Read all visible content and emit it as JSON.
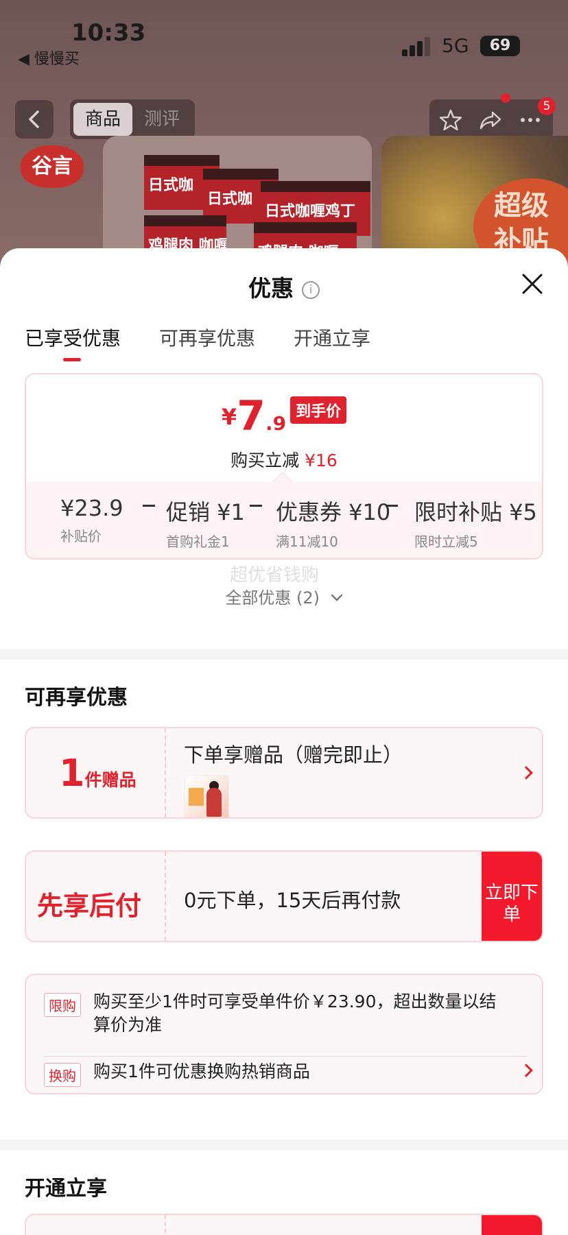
{
  "status_bar": {
    "time": "10:33",
    "back_app": "◀ 慢慢买",
    "network": "5G",
    "battery": "69"
  },
  "product_header": {
    "tabs": [
      "商品",
      "测评"
    ],
    "active_tab": "商品",
    "cart_count": "5",
    "brand_logo": "谷言",
    "package_labels": [
      "日式咖",
      "日式咖",
      "日式咖喱鸡丁",
      "鸡腿肉 咖喱",
      "鸡腿肉 咖喱"
    ],
    "promo_tag": [
      "超级",
      "补贴"
    ]
  },
  "sheet": {
    "title": "优惠",
    "info_icon": "i",
    "tabs": [
      "已享受优惠",
      "可再享优惠",
      "开通立享"
    ],
    "active_tab": 0,
    "final_price": {
      "currency": "¥",
      "integer": "7",
      "decimal": ".9",
      "tag": "到手价",
      "save_label": "购买立减",
      "save_amount": "¥16"
    },
    "breakdown": [
      {
        "value": "¥23.9",
        "label": "补贴价"
      },
      {
        "value": "促销 ¥1",
        "label": "首购礼金1"
      },
      {
        "value": "优惠券 ¥10",
        "label": "满11减10"
      },
      {
        "value": "限时补贴 ¥5",
        "label": "限时立减5"
      }
    ],
    "all_offers": "全部优惠 (2)",
    "watermark": "超优省钱购"
  },
  "more_offers": {
    "title": "可再享优惠",
    "gift": {
      "count": "1",
      "unit": "件赠品",
      "text": "下单享赠品（赠完即止）"
    },
    "pay_later": {
      "label": "先享后付",
      "text": "0元下单，15天后再付款",
      "cta": "立即下单"
    },
    "rules": [
      {
        "tag": "限购",
        "text": "购买至少1件时可享受单件价￥23.90，超出数量以结算价为准"
      },
      {
        "tag": "换购",
        "text": "购买1件可优惠换购热销商品"
      }
    ]
  },
  "open_section": {
    "title": "开通立享"
  },
  "colors": {
    "accent": "#e0222e",
    "cta_red": "#f5192c",
    "card_border": "#f7d5d8",
    "card_bg": "#fdf6f6"
  }
}
